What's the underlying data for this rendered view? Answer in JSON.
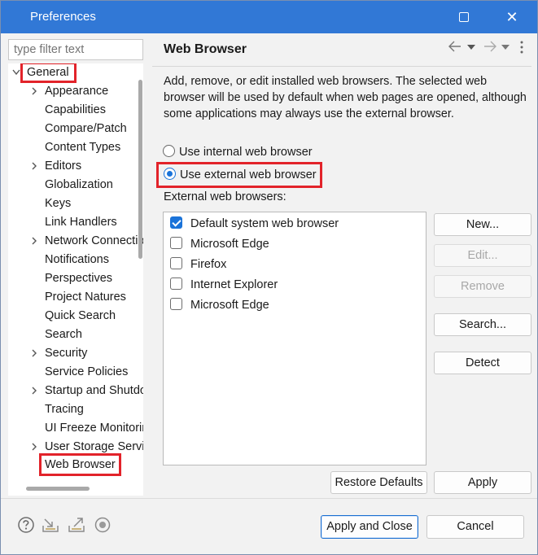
{
  "window": {
    "title": "Preferences",
    "maximize_icon": "maximize-icon",
    "close_glyph": "✕"
  },
  "filter": {
    "placeholder": "type filter text"
  },
  "tree": {
    "items": [
      {
        "label": "General",
        "expandable": true,
        "expanded": true,
        "level": 0
      },
      {
        "label": "Appearance",
        "expandable": true,
        "level": 1
      },
      {
        "label": "Capabilities",
        "expandable": false,
        "level": 1
      },
      {
        "label": "Compare/Patch",
        "expandable": false,
        "level": 1
      },
      {
        "label": "Content Types",
        "expandable": false,
        "level": 1
      },
      {
        "label": "Editors",
        "expandable": true,
        "level": 1
      },
      {
        "label": "Globalization",
        "expandable": false,
        "level": 1
      },
      {
        "label": "Keys",
        "expandable": false,
        "level": 1
      },
      {
        "label": "Link Handlers",
        "expandable": false,
        "level": 1
      },
      {
        "label": "Network Connections",
        "expandable": true,
        "level": 1
      },
      {
        "label": "Notifications",
        "expandable": false,
        "level": 1
      },
      {
        "label": "Perspectives",
        "expandable": false,
        "level": 1
      },
      {
        "label": "Project Natures",
        "expandable": false,
        "level": 1
      },
      {
        "label": "Quick Search",
        "expandable": false,
        "level": 1
      },
      {
        "label": "Search",
        "expandable": false,
        "level": 1
      },
      {
        "label": "Security",
        "expandable": true,
        "level": 1
      },
      {
        "label": "Service Policies",
        "expandable": false,
        "level": 1
      },
      {
        "label": "Startup and Shutdown",
        "expandable": true,
        "level": 1
      },
      {
        "label": "Tracing",
        "expandable": false,
        "level": 1
      },
      {
        "label": "UI Freeze Monitoring",
        "expandable": false,
        "level": 1
      },
      {
        "label": "User Storage Service",
        "expandable": true,
        "level": 1
      },
      {
        "label": "Web Browser",
        "expandable": false,
        "level": 1,
        "selected": true
      }
    ]
  },
  "page": {
    "title": "Web Browser",
    "description": "Add, remove, or edit installed web browsers. The selected web browser will be used by default when web pages are opened, although some applications may always use the external browser.",
    "radio_internal": "Use internal web browser",
    "radio_external": "Use external web browser",
    "selected_mode": "external",
    "list_label": "External web browsers:",
    "browsers": [
      {
        "name": "Default system web browser",
        "checked": true
      },
      {
        "name": "Microsoft Edge",
        "checked": false
      },
      {
        "name": "Firefox",
        "checked": false
      },
      {
        "name": "Internet Explorer",
        "checked": false
      },
      {
        "name": "Microsoft Edge",
        "checked": false
      }
    ],
    "buttons": {
      "new": "New...",
      "edit": "Edit...",
      "remove": "Remove",
      "search": "Search...",
      "detect": "Detect",
      "restore_defaults": "Restore Defaults",
      "apply": "Apply"
    }
  },
  "footer": {
    "apply_and_close": "Apply and Close",
    "cancel": "Cancel"
  },
  "colors": {
    "titlebar": "#3178d6",
    "accent": "#1a73d9",
    "highlight": "#e2232a"
  }
}
